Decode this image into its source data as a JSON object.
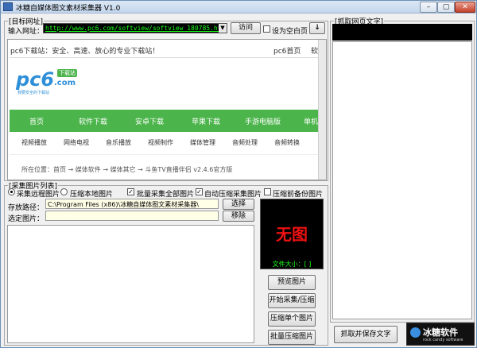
{
  "window": {
    "title": "冰糖自媒体图文素材采集器 V1.0",
    "min": "–",
    "max": "▢",
    "close": "✕"
  },
  "target": {
    "legend": "[目标网址]",
    "url_label": "输入网址：",
    "url_value": "http://www.pc6.com/softview/softview_180785.html",
    "visit": "访问",
    "blank_label": "设为空白页",
    "go": "↓"
  },
  "browser": {
    "top_text": "pc6下载站：安全、高速、放心的专业下载站！",
    "top_right": [
      "pc6首页",
      "软"
    ],
    "logo": {
      "text": "pc6",
      "suffix": ".com",
      "badge": "下载站",
      "slogan": "我要安全的下载站"
    },
    "nav": [
      "首页",
      "软件下载",
      "安卓下载",
      "苹果下载",
      "手游电脑版",
      "单机"
    ],
    "sub_nav": [
      "视频播放",
      "网络电视",
      "音乐播放",
      "视频制作",
      "媒体管理",
      "音频处理",
      "音频转换"
    ],
    "breadcrumb": "所在位置：首页 → 媒体软件 → 媒体其它 → 斗鱼TV直播伴侣 v2.4.6官方版"
  },
  "collect": {
    "legend": "[采集图片列表]",
    "remote": "采集远程图片",
    "local": "压缩本地图片",
    "batch": "批量采集全部图片",
    "auto": "自动压缩采集图片",
    "backup": "压缩前备份图片",
    "path_label": "存放路径：",
    "path_value": "C:\\Program Files (x86)\\冰糖自媒体图文素材采集器\\",
    "select": "选择",
    "sel_label": "选定图片：",
    "remove": "移除",
    "no_image": "无图",
    "size_label": "文件大小：[ ]"
  },
  "actions": [
    "预览图片",
    "开始采集/压缩",
    "压缩单个图片",
    "批量压缩图片"
  ],
  "right": {
    "legend": "[抓取网页文字]",
    "save": "抓取并保存文字",
    "brand": "冰糖软件",
    "brand_sub": "rock candy software"
  }
}
